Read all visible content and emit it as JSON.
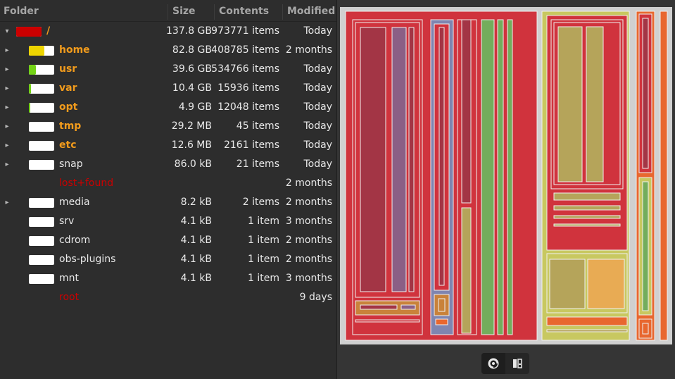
{
  "columns": {
    "folder": "Folder",
    "size": "Size",
    "contents": "Contents",
    "modified": "Modified"
  },
  "rows": [
    {
      "expander": "▾",
      "name": "/",
      "size": "137.8 GB",
      "contents": "973771 items",
      "modified": "Today",
      "bar_color": "#cc0000",
      "fill": 1.0,
      "name_color": "#f19b1c",
      "bold": true
    },
    {
      "expander": "▸",
      "name": "home",
      "size": "82.8 GB",
      "contents": "408785 items",
      "modified": "2 months",
      "bar_color": "#edd400",
      "fill": 0.6,
      "name_color": "#f19b1c",
      "bold": true
    },
    {
      "expander": "▸",
      "name": "usr",
      "size": "39.6 GB",
      "contents": "534766 items",
      "modified": "Today",
      "bar_color": "#73d216",
      "fill": 0.29,
      "name_color": "#f19b1c",
      "bold": true
    },
    {
      "expander": "▸",
      "name": "var",
      "size": "10.4 GB",
      "contents": "15936 items",
      "modified": "Today",
      "bar_color": "#73d216",
      "fill": 0.075,
      "name_color": "#f19b1c",
      "bold": true
    },
    {
      "expander": "▸",
      "name": "opt",
      "size": "4.9 GB",
      "contents": "12048 items",
      "modified": "Today",
      "bar_color": "#73d216",
      "fill": 0.035,
      "name_color": "#f19b1c",
      "bold": true
    },
    {
      "expander": "▸",
      "name": "tmp",
      "size": "29.2 MB",
      "contents": "45 items",
      "modified": "Today",
      "bar_color": "#73d216",
      "fill": 0.0,
      "name_color": "#f19b1c",
      "bold": true
    },
    {
      "expander": "▸",
      "name": "etc",
      "size": "12.6 MB",
      "contents": "2161 items",
      "modified": "Today",
      "bar_color": "#73d216",
      "fill": 0.0,
      "name_color": "#f19b1c",
      "bold": true
    },
    {
      "expander": "▸",
      "name": "snap",
      "size": "86.0 kB",
      "contents": "21 items",
      "modified": "Today",
      "bar_color": "#73d216",
      "fill": 0.0,
      "name_color": "#e8e8e8",
      "bold": false
    },
    {
      "expander": "",
      "name": "lost+found",
      "size": "",
      "contents": "",
      "modified": "2 months",
      "bar_color": "",
      "fill": 0.0,
      "name_color": "#cc0000",
      "bold": false,
      "no_bar": true
    },
    {
      "expander": "▸",
      "name": "media",
      "size": "8.2 kB",
      "contents": "2 items",
      "modified": "2 months",
      "bar_color": "#73d216",
      "fill": 0.0,
      "name_color": "#e8e8e8",
      "bold": false
    },
    {
      "expander": "",
      "name": "srv",
      "size": "4.1 kB",
      "contents": "1 item",
      "modified": "3 months",
      "bar_color": "#73d216",
      "fill": 0.0,
      "name_color": "#e8e8e8",
      "bold": false
    },
    {
      "expander": "",
      "name": "cdrom",
      "size": "4.1 kB",
      "contents": "1 item",
      "modified": "2 months",
      "bar_color": "#73d216",
      "fill": 0.0,
      "name_color": "#e8e8e8",
      "bold": false
    },
    {
      "expander": "",
      "name": "obs-plugins",
      "size": "4.1 kB",
      "contents": "1 item",
      "modified": "2 months",
      "bar_color": "#73d216",
      "fill": 0.0,
      "name_color": "#e8e8e8",
      "bold": false
    },
    {
      "expander": "",
      "name": "mnt",
      "size": "4.1 kB",
      "contents": "1 item",
      "modified": "3 months",
      "bar_color": "#73d216",
      "fill": 0.0,
      "name_color": "#e8e8e8",
      "bold": false
    },
    {
      "expander": "",
      "name": "root",
      "size": "",
      "contents": "",
      "modified": "9 days",
      "bar_color": "",
      "fill": 0.0,
      "name_color": "#cc0000",
      "bold": false,
      "no_bar": true
    }
  ],
  "treemap_colors": {
    "root": "#d0333d",
    "red_dark": "#a33545",
    "purple": "#8b5f85",
    "slate": "#7f85b0",
    "green": "#73ad5c",
    "olive": "#b5a45a",
    "amber": "#c9823a",
    "lime_frame": "#c8c860",
    "orange": "#e8672f",
    "orange_light": "#e8ab54",
    "bg": "#d0d0d0"
  },
  "view_buttons": [
    {
      "name": "rings-chart-view-button",
      "icon": "rings-chart-icon",
      "active": true
    },
    {
      "name": "treemap-chart-view-button",
      "icon": "treemap-chart-icon",
      "active": false
    }
  ]
}
